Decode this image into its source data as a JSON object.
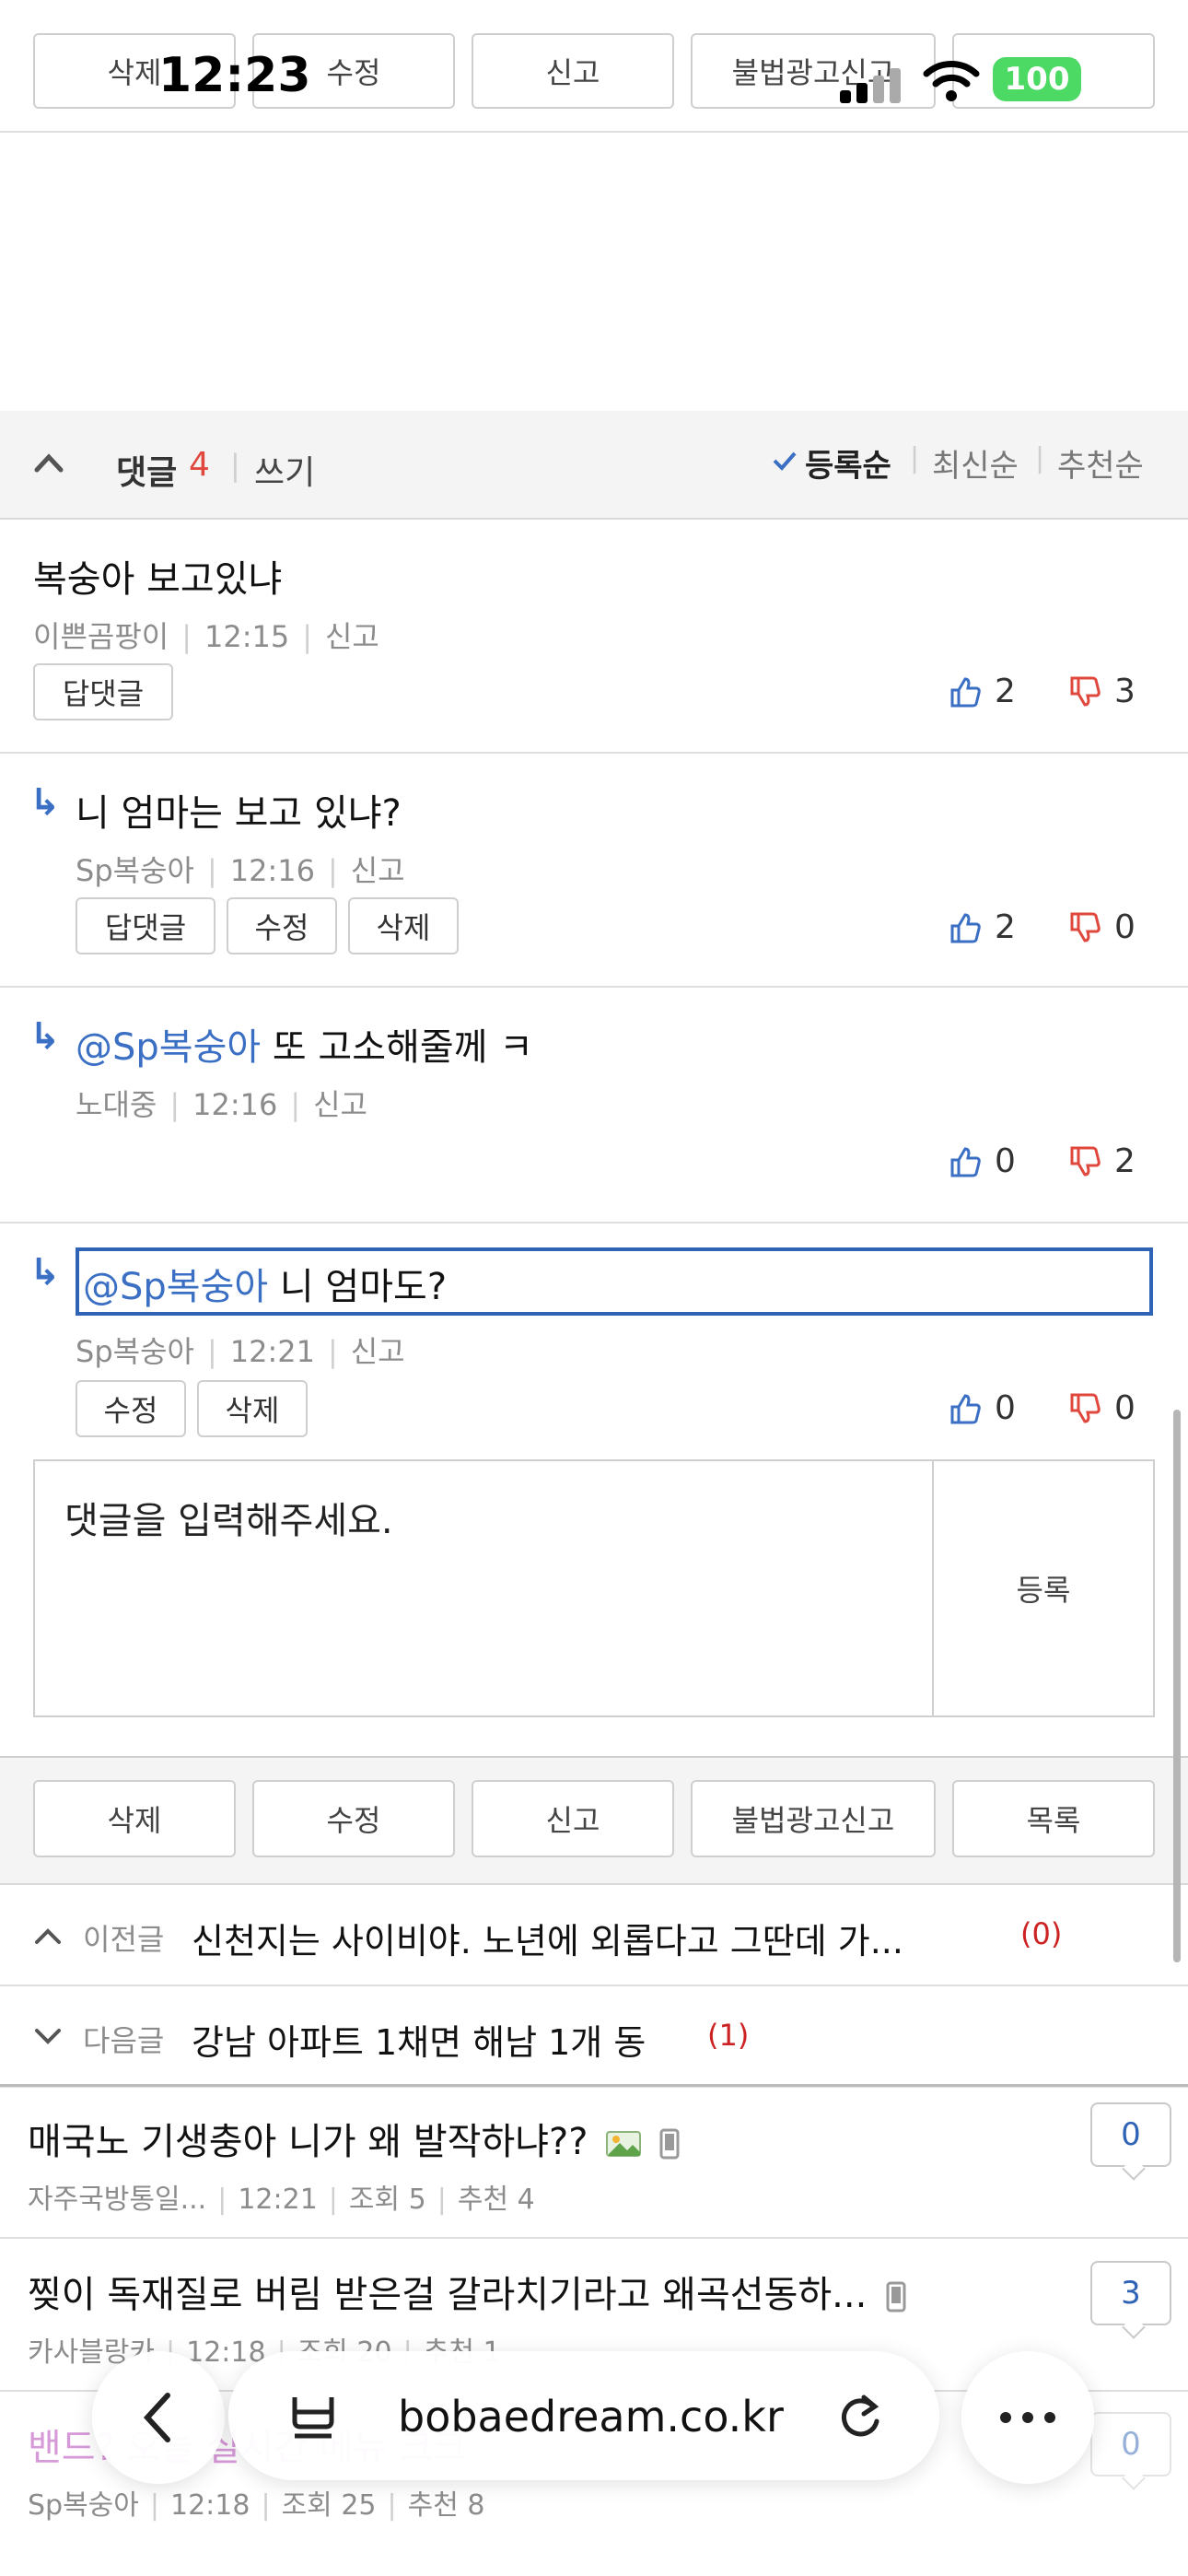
{
  "status_bar": {
    "time": "12:23",
    "battery": "100"
  },
  "top_actions": [
    "삭제",
    "수정",
    "신고",
    "불법광고신고",
    "목록"
  ],
  "comment_header": {
    "label": "댓글",
    "count": "4",
    "write": "쓰기",
    "sort_options": [
      "등록순",
      "최신순",
      "추천순"
    ],
    "active_sort": "등록순"
  },
  "comments": [
    {
      "text": "복숭아 보고있냐",
      "author": "이쁜곰팡이",
      "time": "12:15",
      "report": "신고",
      "buttons": [
        "답댓글"
      ],
      "up": "2",
      "down": "3"
    },
    {
      "text": "니 엄마는 보고 있냐?",
      "author": "Sp복숭아",
      "time": "12:16",
      "report": "신고",
      "buttons": [
        "답댓글",
        "수정",
        "삭제"
      ],
      "up": "2",
      "down": "0"
    },
    {
      "mention": "@Sp복숭아",
      "text": "또 고소해줄께 ㅋ",
      "author": "노대중",
      "time": "12:16",
      "report": "신고",
      "buttons": [],
      "up": "0",
      "down": "2"
    },
    {
      "mention": "@Sp복숭아",
      "text": "니 엄마도?",
      "author": "Sp복숭아",
      "time": "12:21",
      "report": "신고",
      "buttons": [
        "수정",
        "삭제"
      ],
      "up": "0",
      "down": "0"
    }
  ],
  "comment_input": {
    "placeholder": "댓글을 입력해주세요.",
    "submit": "등록"
  },
  "bottom_actions": [
    "삭제",
    "수정",
    "신고",
    "불법광고신고",
    "목록"
  ],
  "prev_post": {
    "label": "이전글",
    "title": "신천지는 사이비야. 노년에 외롭다고 그딴데 가...",
    "count": "(0)"
  },
  "next_post": {
    "label": "다음글",
    "title": "강남 아파트 1채면 해남 1개 동",
    "count": "(1)"
  },
  "posts": [
    {
      "title": "매국노 기생충아 니가 왜 발작하냐??",
      "author": "자주국방통일...",
      "time": "12:21",
      "views": "조회 5",
      "recommend": "추천 4",
      "comments": "0"
    },
    {
      "title": "찢이 독재질로 버림 받은걸 갈라치기라고 왜곡선동하...",
      "author": "카사블랑카",
      "time": "12:18",
      "views": "조회 20",
      "recommend": "추천 1",
      "comments": "3"
    },
    {
      "title": "밴드? 오늘 실시간 메뉴 크크",
      "author": "Sp복숭아",
      "time": "12:18",
      "views": "조회 25",
      "recommend": "추천 8",
      "comments": "0"
    }
  ],
  "browser": {
    "url": "bobaedream.co.kr"
  }
}
